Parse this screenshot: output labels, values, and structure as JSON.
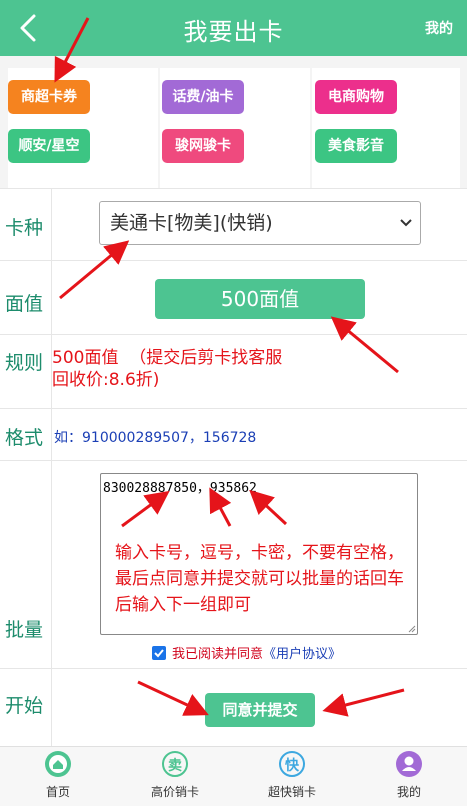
{
  "header": {
    "title": "我要出卡",
    "mine": "我的",
    "back_icon": "chevron-left-icon"
  },
  "categories": [
    {
      "label": "商超卡券",
      "color": "#f5831f"
    },
    {
      "label": "话费/油卡",
      "color": "#a26ad6"
    },
    {
      "label": "电商购物",
      "color": "#ec2f8c"
    },
    {
      "label": "顺安/星空",
      "color": "#3cc583"
    },
    {
      "label": "骏网骏卡",
      "color": "#ef4a7e"
    },
    {
      "label": "美食影音",
      "color": "#3cc583"
    }
  ],
  "form": {
    "card_type_label": "卡种",
    "card_type_value": "美通卡[物美](快销)",
    "face_value_label": "面值",
    "face_value": "500面值",
    "rule_label": "规则",
    "rule_text": "500面值  （提交后剪卡找客服\n回收价:8.6折)",
    "format_label": "格式",
    "format_text": "如：910000289507，156728",
    "batch_label": "批量",
    "batch_value": "830028887850，935862",
    "batch_hint": "输入卡号，逗号，卡密，不要有空格，最后点同意并提交就可以批量的话回车后输入下一组即可",
    "agree_text": "我已阅读并同意",
    "agree_link": "《用户协议》",
    "start_label": "开始",
    "submit_label": "同意并提交"
  },
  "bottom_nav": [
    {
      "label": "首页",
      "icon": "home-icon",
      "color": "#4dc491"
    },
    {
      "label": "高价销卡",
      "icon": "sell-icon",
      "color": "#4dc491",
      "glyph": "卖"
    },
    {
      "label": "超快销卡",
      "icon": "fast-icon",
      "color": "#3da8e0",
      "glyph": "快"
    },
    {
      "label": "我的",
      "icon": "user-icon",
      "color": "#a26ad6"
    }
  ],
  "colors": {
    "accent": "#4dc491",
    "annotation": "#e5141a"
  }
}
